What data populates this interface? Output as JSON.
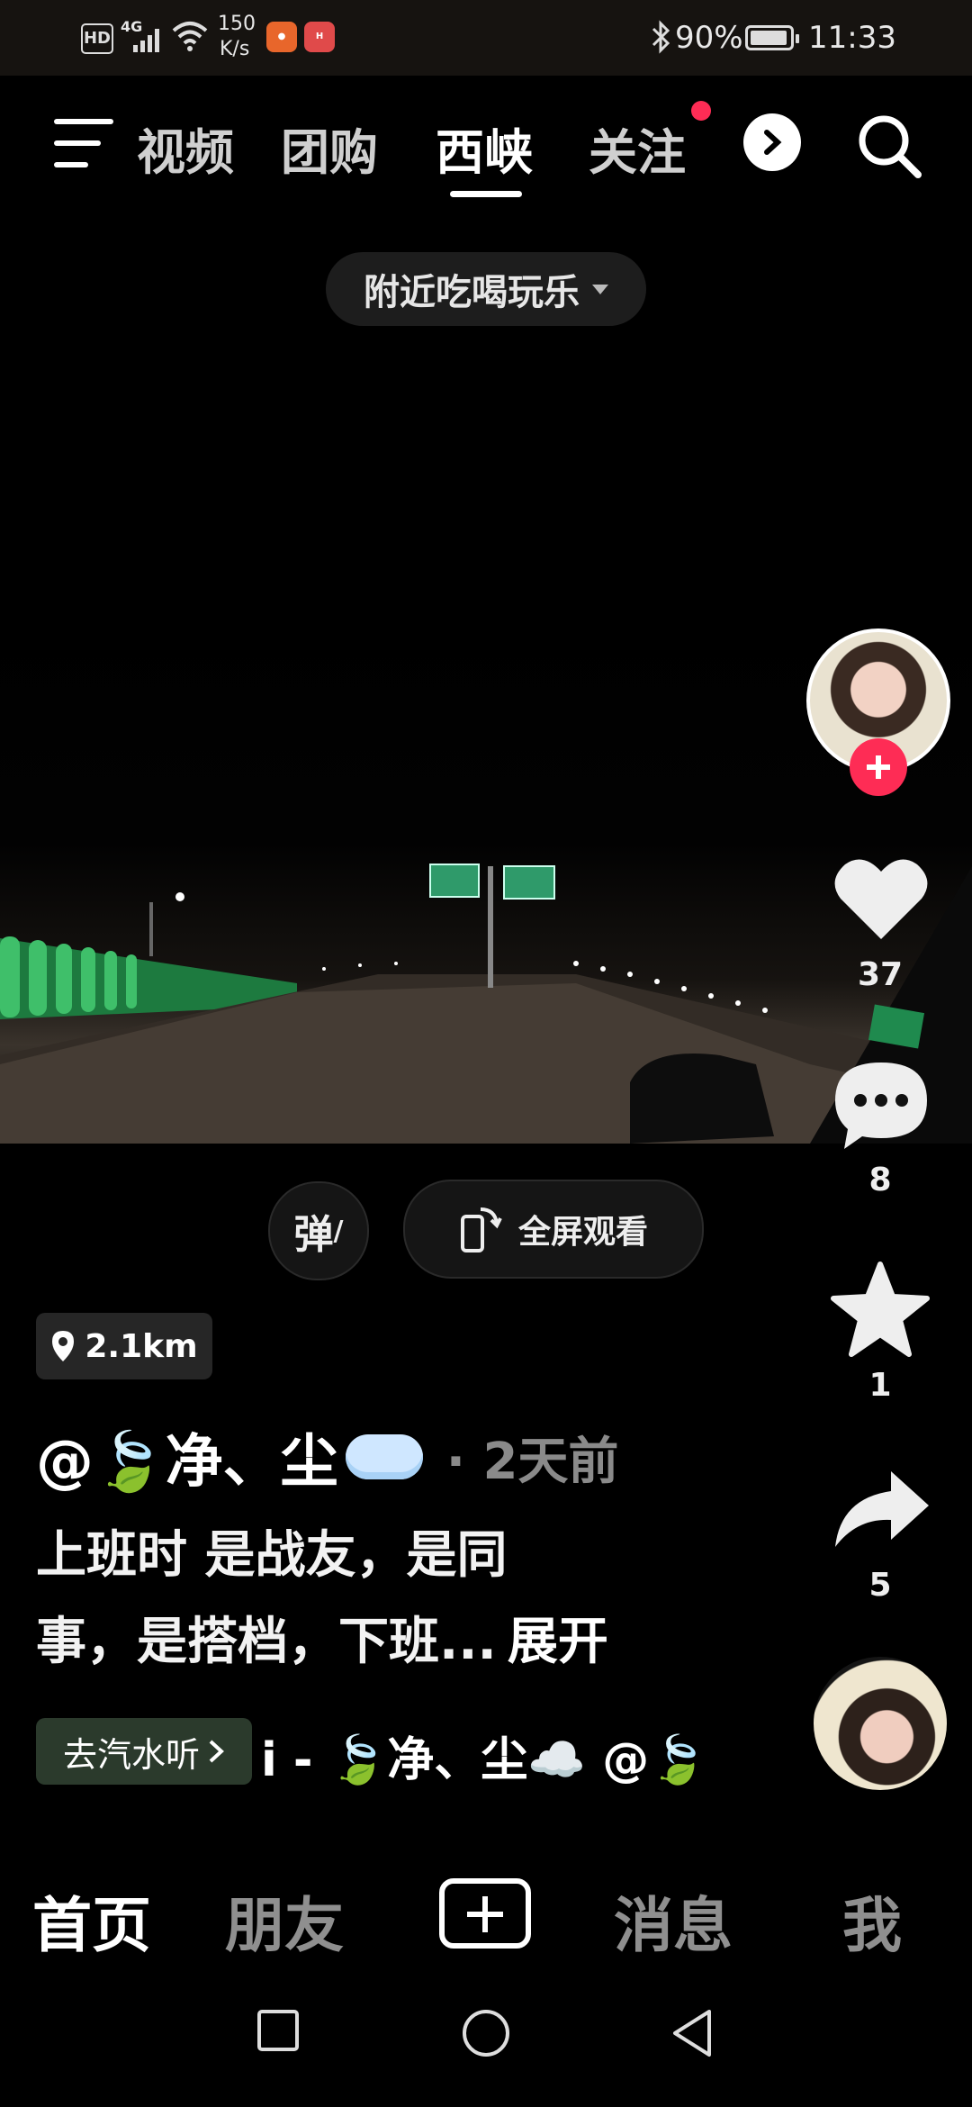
{
  "status_bar": {
    "hd": "HD",
    "network": "4G",
    "speed_value": "150",
    "speed_unit": "K/s",
    "battery": "90%",
    "time": "11:33"
  },
  "top_tabs": {
    "items": [
      "视频",
      "团购",
      "西峡",
      "关注"
    ],
    "active": "西峡"
  },
  "filter_pill": {
    "label": "附近吃喝玩乐"
  },
  "rail": {
    "like_count": "37",
    "comment_count": "8",
    "favorite_count": "1",
    "share_count": "5"
  },
  "video_buttons": {
    "danmu": "弹",
    "fullscreen": "全屏观看"
  },
  "post": {
    "distance": "2.1km",
    "author": "@🍃净、尘",
    "time_ago": "· 2天前",
    "desc_line1": "上班时 是战友，是同",
    "desc_line2": "事，是搭档，下班...",
    "expand": "展开",
    "music_button": "去汽水听",
    "music_text": "i - 🍃净、尘☁️    @🍃"
  },
  "bottom_nav": {
    "home": "首页",
    "friends": "朋友",
    "messages": "消息",
    "me": "我"
  },
  "colors": {
    "accent_red": "#fe2c55",
    "background": "#000000",
    "music_green": "#2b3a2c"
  }
}
